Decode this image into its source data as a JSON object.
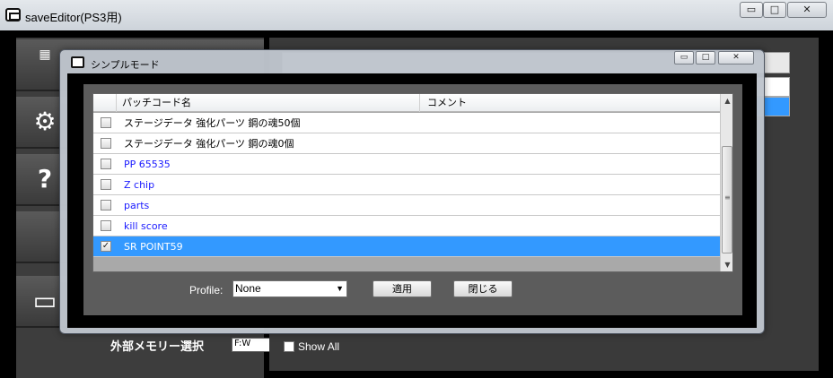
{
  "main_window": {
    "title": "saveEditor(PS3用)",
    "controls": {
      "minimize": "▭",
      "maximize": "□",
      "close": "✕"
    },
    "right_panel": {
      "show_all_label": "Show All"
    },
    "left_panel": {
      "external_memory_label": "外部メモリー選択",
      "drive_value": "F:W"
    }
  },
  "dialog": {
    "title": "シンプルモード",
    "controls": {
      "minimize": "▭",
      "maximize": "□",
      "close": "✕"
    },
    "columns": [
      "パッチコード名",
      "コメント"
    ],
    "rows": [
      {
        "name": "ステージデータ 強化パーツ 鋼の魂50個",
        "checked": false,
        "color": "black",
        "selected": false
      },
      {
        "name": "ステージデータ 強化パーツ 鋼の魂0個",
        "checked": false,
        "color": "black",
        "selected": false
      },
      {
        "name": "PP 65535",
        "checked": false,
        "color": "blue",
        "selected": false
      },
      {
        "name": "Z chip",
        "checked": false,
        "color": "blue",
        "selected": false
      },
      {
        "name": "parts",
        "checked": false,
        "color": "blue",
        "selected": false
      },
      {
        "name": "kill score",
        "checked": false,
        "color": "blue",
        "selected": false
      },
      {
        "name": "SR POINT59",
        "checked": true,
        "color": "black",
        "selected": true
      }
    ],
    "profile_label": "Profile:",
    "profile_value": "None",
    "apply_label": "適用",
    "close_label": "閉じる"
  }
}
